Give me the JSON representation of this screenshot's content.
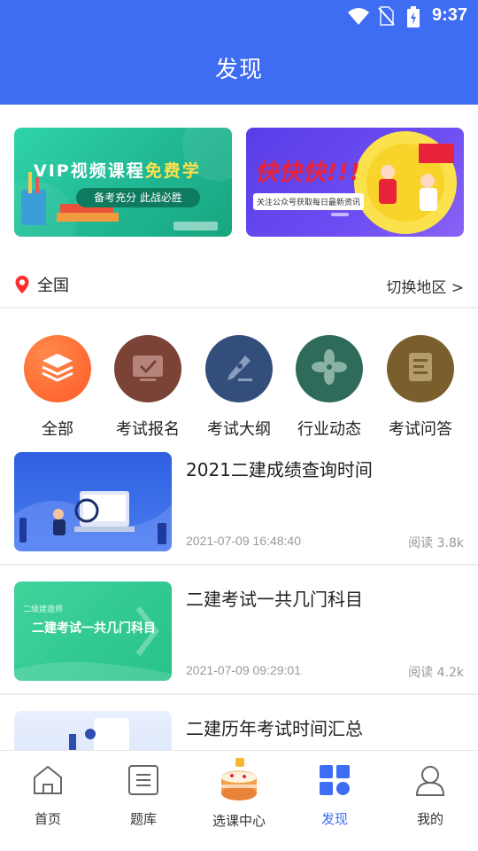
{
  "status_bar": {
    "time": "9:37"
  },
  "header": {
    "title": "发现"
  },
  "banners": [
    {
      "title_a": "VIP视频课程",
      "title_b": "免费学",
      "subtitle": "备考充分 此战必胜"
    },
    {
      "title": "快快快!!!",
      "subtitle": "关注公众号获取每日最新资讯"
    }
  ],
  "location": {
    "current": "全国",
    "switch_label": "切换地区 >"
  },
  "categories": [
    {
      "label": "全部",
      "color": "#fe6b35"
    },
    {
      "label": "考试报名",
      "color": "#7b4236"
    },
    {
      "label": "考试大纲",
      "color": "#344e7c"
    },
    {
      "label": "行业动态",
      "color": "#2f6b5b"
    },
    {
      "label": "考试问答",
      "color": "#7a5f2c"
    }
  ],
  "articles": [
    {
      "title": "2021二建成绩查询时间",
      "date": "2021-07-09 16:48:40",
      "reads": "阅读 3.8k"
    },
    {
      "title": "二建考试一共几门科目",
      "date": "2021-07-09 09:29:01",
      "reads": "阅读 4.2k",
      "thumb_small": "二级建造师",
      "thumb_big": "二建考试一共几门科目"
    },
    {
      "title": "二建历年考试时间汇总"
    }
  ],
  "nav": [
    {
      "label": "首页"
    },
    {
      "label": "题库"
    },
    {
      "label": "选课中心"
    },
    {
      "label": "发现",
      "active": true
    },
    {
      "label": "我的"
    }
  ],
  "colors": {
    "brand": "#3e6cf2",
    "text_muted": "#999999"
  }
}
